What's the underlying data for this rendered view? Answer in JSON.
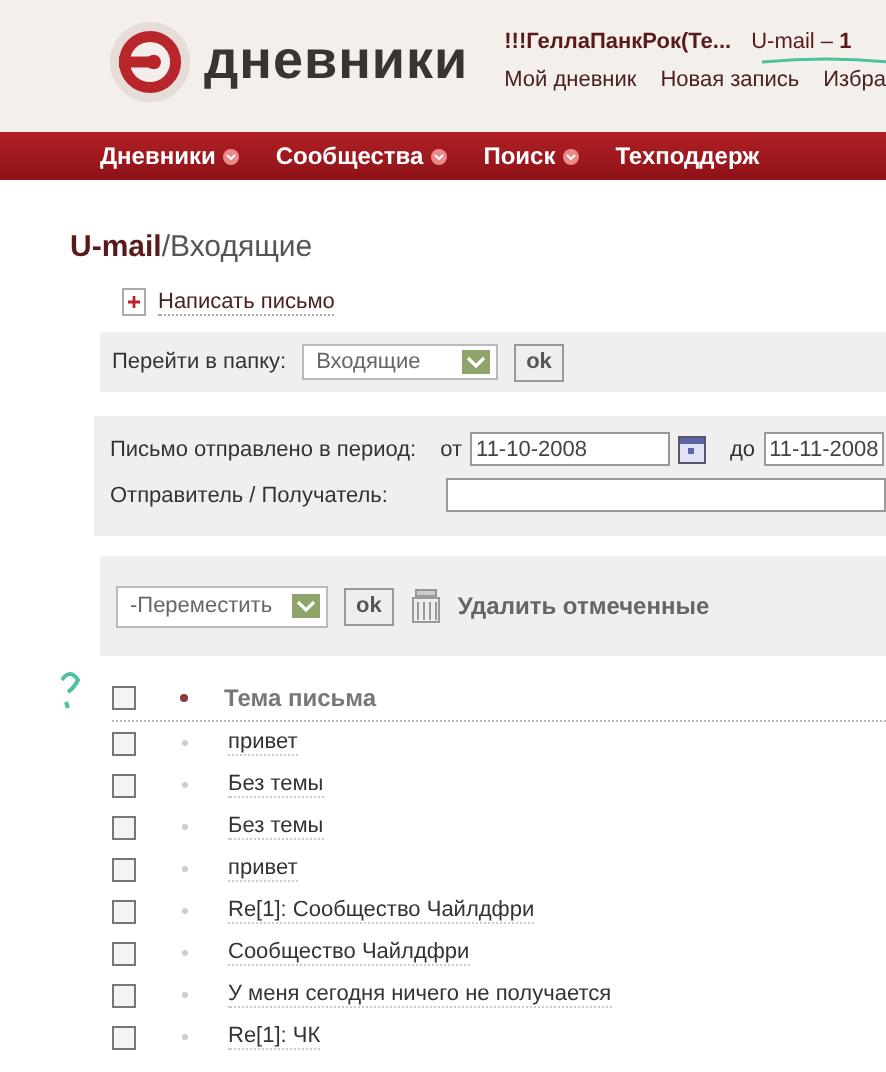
{
  "header": {
    "logo_text": "дневники",
    "user": "!!!ГеллаПанкРок(Те...",
    "umail": "U-mail – **1**",
    "links": [
      "Мой дневник",
      "Новая запись",
      "Избра"
    ]
  },
  "nav": [
    "Дневники",
    "Сообщества",
    "Поиск",
    "Техподдерж"
  ],
  "breadcrumb": {
    "section": "U-mail",
    "separator": "/",
    "page": "Входящие"
  },
  "compose": "Написать письмо",
  "folder": {
    "label": "Перейти в папку:",
    "value": "Входящие",
    "button": "ok"
  },
  "filter": {
    "period_label": "Письмо отправлено в период:",
    "from_label": "от",
    "from": "11-10-2008",
    "to_label": "до",
    "to": "11-11-2008",
    "sender_label": "Отправитель / Получатель:"
  },
  "actions": {
    "move": "-Переместить",
    "button": "ok",
    "delete": "Удалить отмеченные"
  },
  "table": {
    "header": "Тема письма",
    "header_checked": false,
    "rows": [
      {
        "subject": "привет",
        "checked": false
      },
      {
        "subject": "Без темы",
        "checked": false
      },
      {
        "subject": "Без темы",
        "checked": false
      },
      {
        "subject": "привет",
        "checked": false
      },
      {
        "subject": "Re[1]: Сообщество Чайлдфри",
        "checked": false
      },
      {
        "subject": "Сообщество Чайлдфри",
        "checked": false
      },
      {
        "subject": "У меня сегодня ничего не получается",
        "checked": false
      },
      {
        "subject": "Re[1]: ЧК",
        "checked": false
      }
    ]
  }
}
